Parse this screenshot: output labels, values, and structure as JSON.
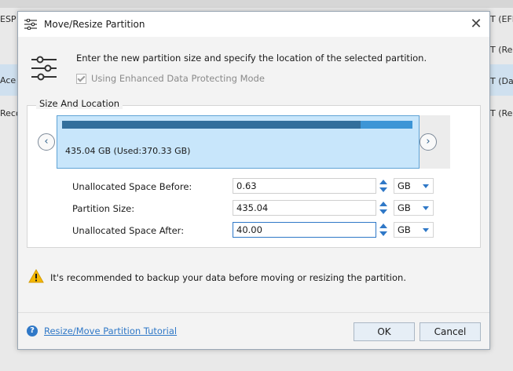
{
  "background": {
    "left_rows": [
      "ESP",
      "Ace",
      "Reco"
    ],
    "right_rows": [
      "T (EFI",
      "T (Re",
      "T (Dat",
      "T (Rec"
    ]
  },
  "dialog": {
    "title": "Move/Resize Partition",
    "close_label": "✕",
    "instruction": "Enter the new partition size and specify the location of the selected partition.",
    "protect_label": "Using Enhanced Data Protecting Mode",
    "protect_checked": true,
    "group_label": "Size And Location",
    "partition": {
      "label": "435.04 GB (Used:370.33 GB)",
      "used_fraction": 0.851
    },
    "nav": {
      "prev": "‹",
      "next": "›"
    },
    "fields": [
      {
        "label": "Unallocated Space Before:",
        "value": "0.63",
        "unit": "GB"
      },
      {
        "label": "Partition Size:",
        "value": "435.04",
        "unit": "GB"
      },
      {
        "label": "Unallocated Space After:",
        "value": "40.00",
        "unit": "GB"
      }
    ],
    "warning": "It's recommended to backup your data before moving or resizing the partition.",
    "help_icon": "?",
    "help_link": "Resize/Move Partition Tutorial",
    "ok_label": "OK",
    "cancel_label": "Cancel"
  },
  "colors": {
    "accent": "#2f78c7",
    "partition_fill": "#c8e6fb",
    "used_bar": "#336f9b",
    "free_bar": "#3c95d6",
    "warning": "#f5b800"
  },
  "icons": {
    "title": "sliders-icon",
    "header": "sliders-icon",
    "warning": "warning-icon",
    "help": "help-icon"
  }
}
